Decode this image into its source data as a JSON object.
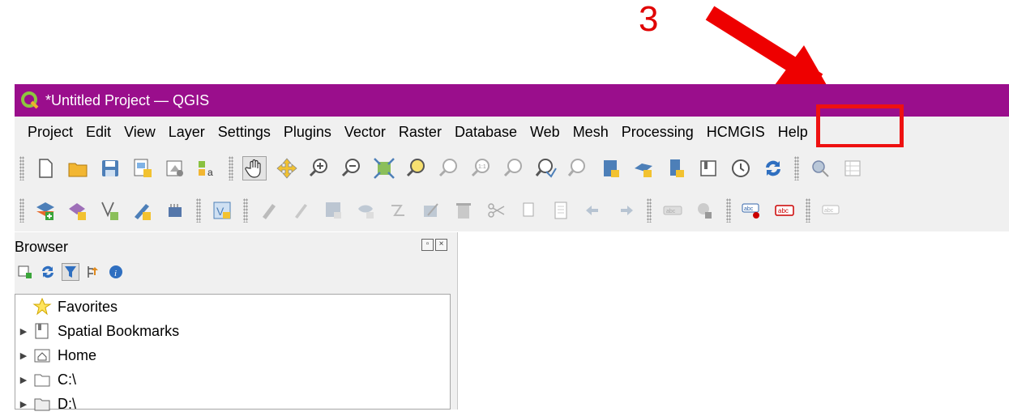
{
  "annotation": {
    "step_number": "3",
    "color": "#e00000"
  },
  "window": {
    "title": "*Untitled Project — QGIS",
    "titlebar_color": "#9a0e8c"
  },
  "menu": {
    "items": [
      {
        "label": "Project"
      },
      {
        "label": "Edit"
      },
      {
        "label": "View"
      },
      {
        "label": "Layer"
      },
      {
        "label": "Settings"
      },
      {
        "label": "Plugins"
      },
      {
        "label": "Vector"
      },
      {
        "label": "Raster"
      },
      {
        "label": "Database"
      },
      {
        "label": "Web"
      },
      {
        "label": "Mesh"
      },
      {
        "label": "Processing"
      },
      {
        "label": "HCMGIS"
      },
      {
        "label": "Help"
      }
    ],
    "highlighted": "HCMGIS"
  },
  "toolbar1": {
    "icons": [
      "new-project-icon",
      "open-project-icon",
      "save-project-icon",
      "new-print-layout-icon",
      "layout-manager-icon",
      "style-manager-icon",
      "pan-icon",
      "pan-to-selection-icon",
      "zoom-in-icon",
      "zoom-out-icon",
      "zoom-full-icon",
      "zoom-to-selection-icon",
      "zoom-to-layer-icon",
      "zoom-native-icon",
      "zoom-last-icon",
      "zoom-next-icon",
      "new-map-view-icon",
      "new-3d-map-view-icon",
      "new-spatial-bookmark-icon",
      "show-bookmarks-icon",
      "temporal-controller-icon",
      "refresh-icon",
      "identify-icon",
      "attribute-table-icon",
      "statistics-icon"
    ]
  },
  "toolbar2": {
    "icons": [
      "data-source-manager-icon",
      "new-geopackage-layer-icon",
      "digitize-vertex-icon",
      "digitize-pencil-icon",
      "new-temporary-layer-icon",
      "virtual-layer-icon",
      "current-edits-icon",
      "toggle-editing-icon",
      "save-edits-icon",
      "add-feature-icon",
      "vertex-tool-icon",
      "modify-attributes-icon",
      "delete-selected-icon",
      "cut-features-icon",
      "copy-features-icon",
      "paste-features-icon",
      "undo-icon",
      "redo-icon",
      "label-toolbar-icon",
      "diagram-icon",
      "pin-label-icon",
      "show-hide-labels-icon",
      "move-label-icon"
    ]
  },
  "browser": {
    "title": "Browser",
    "tools": [
      "add-selected-layers-icon",
      "refresh-icon",
      "filter-icon",
      "collapse-all-icon",
      "properties-icon"
    ],
    "items": [
      {
        "label": "Favorites",
        "icon": "star-icon",
        "expandable": false
      },
      {
        "label": "Spatial Bookmarks",
        "icon": "bookmark-book-icon",
        "expandable": true
      },
      {
        "label": "Home",
        "icon": "home-folder-icon",
        "expandable": true
      },
      {
        "label": "C:\\",
        "icon": "folder-icon",
        "expandable": true
      },
      {
        "label": "D:\\",
        "icon": "drive-folder-icon",
        "expandable": true
      }
    ]
  }
}
